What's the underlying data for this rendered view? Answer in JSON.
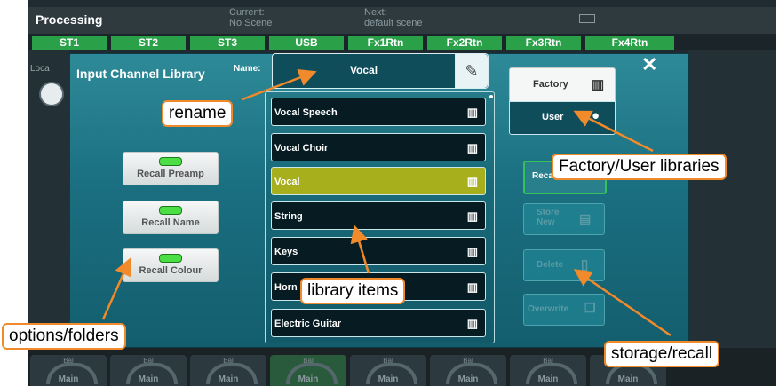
{
  "topbar": {
    "title": "Processing",
    "current_label": "Current:",
    "current_value": "No Scene",
    "next_label": "Next:",
    "next_value": "default scene"
  },
  "channels": [
    "ST1",
    "ST2",
    "ST3",
    "USB",
    "Fx1Rtn",
    "Fx2Rtn",
    "Fx3Rtn",
    "Fx4Rtn"
  ],
  "bottom_strip": {
    "bal_label": "Bal",
    "main_label": "Main"
  },
  "left_peek": {
    "loca": "Loca"
  },
  "dialog": {
    "title": "Input Channel Library",
    "name_label": "Name:",
    "name_value": "Vocal",
    "close_glyph": "✕",
    "items": [
      {
        "label": "Vocal Speech",
        "selected": false
      },
      {
        "label": "Vocal Choir",
        "selected": false
      },
      {
        "label": "Vocal",
        "selected": true
      },
      {
        "label": "String",
        "selected": false
      },
      {
        "label": "Keys",
        "selected": false
      },
      {
        "label": "Horn",
        "selected": false
      },
      {
        "label": "Electric Guitar",
        "selected": false
      }
    ],
    "options": [
      "Recall Preamp",
      "Recall Name",
      "Recall Colour"
    ],
    "library_tabs": {
      "factory": "Factory",
      "user": "User"
    },
    "actions": {
      "recall": "Recall",
      "store_new": "Store New",
      "delete": "Delete",
      "overwrite": "Overwrite"
    }
  },
  "callouts": {
    "rename": "rename",
    "factory_user": "Factory/User libraries",
    "library_items": "library items",
    "options": "options/folders",
    "storage": "storage/recall"
  },
  "colors": {
    "accent_green": "#2aa049",
    "selected_item": "#a7b01c",
    "dialog_teal": "#1a6f80",
    "callout_border": "#f08a2a"
  },
  "icons": {
    "item_icon": "factory-icon",
    "name_edit": "pencil-icon"
  }
}
